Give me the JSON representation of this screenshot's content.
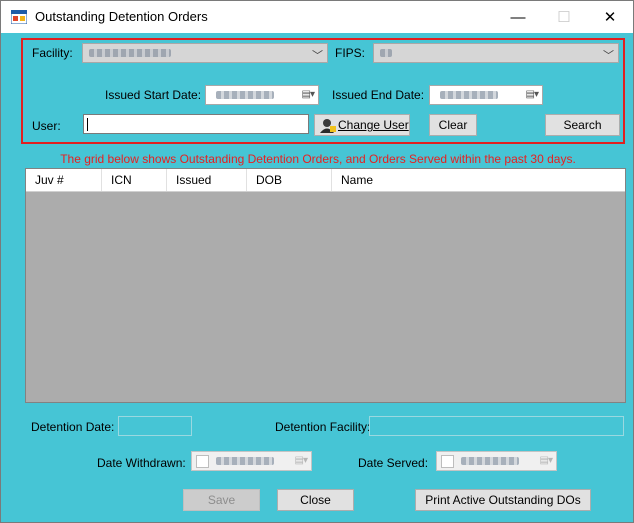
{
  "window": {
    "title": "Outstanding Detention Orders",
    "controls": {
      "minimize": "—",
      "maximize": "☐",
      "close": "✕"
    }
  },
  "filters": {
    "facility_label": "Facility:",
    "fips_label": "FIPS:",
    "issued_start_label": "Issued Start Date:",
    "issued_end_label": "Issued End Date:",
    "user_label": "User:",
    "change_user_label": "Change User",
    "clear_label": "Clear",
    "search_label": "Search"
  },
  "notice": "The grid below shows Outstanding Detention Orders, and Orders Served within the past 30 days.",
  "grid": {
    "columns": [
      "Juv #",
      "ICN",
      "Issued",
      "DOB",
      "Name"
    ],
    "rows": []
  },
  "details": {
    "detention_date_label": "Detention Date:",
    "detention_facility_label": "Detention Facility:",
    "date_withdrawn_label": "Date Withdrawn:",
    "date_served_label": "Date Served:"
  },
  "actions": {
    "save_label": "Save",
    "close_label": "Close",
    "print_label": "Print Active Outstanding DOs"
  },
  "colors": {
    "background": "#46c5d5",
    "highlight_border": "#e02020",
    "notice_text": "#e82020",
    "grid_empty": "#acacac"
  }
}
